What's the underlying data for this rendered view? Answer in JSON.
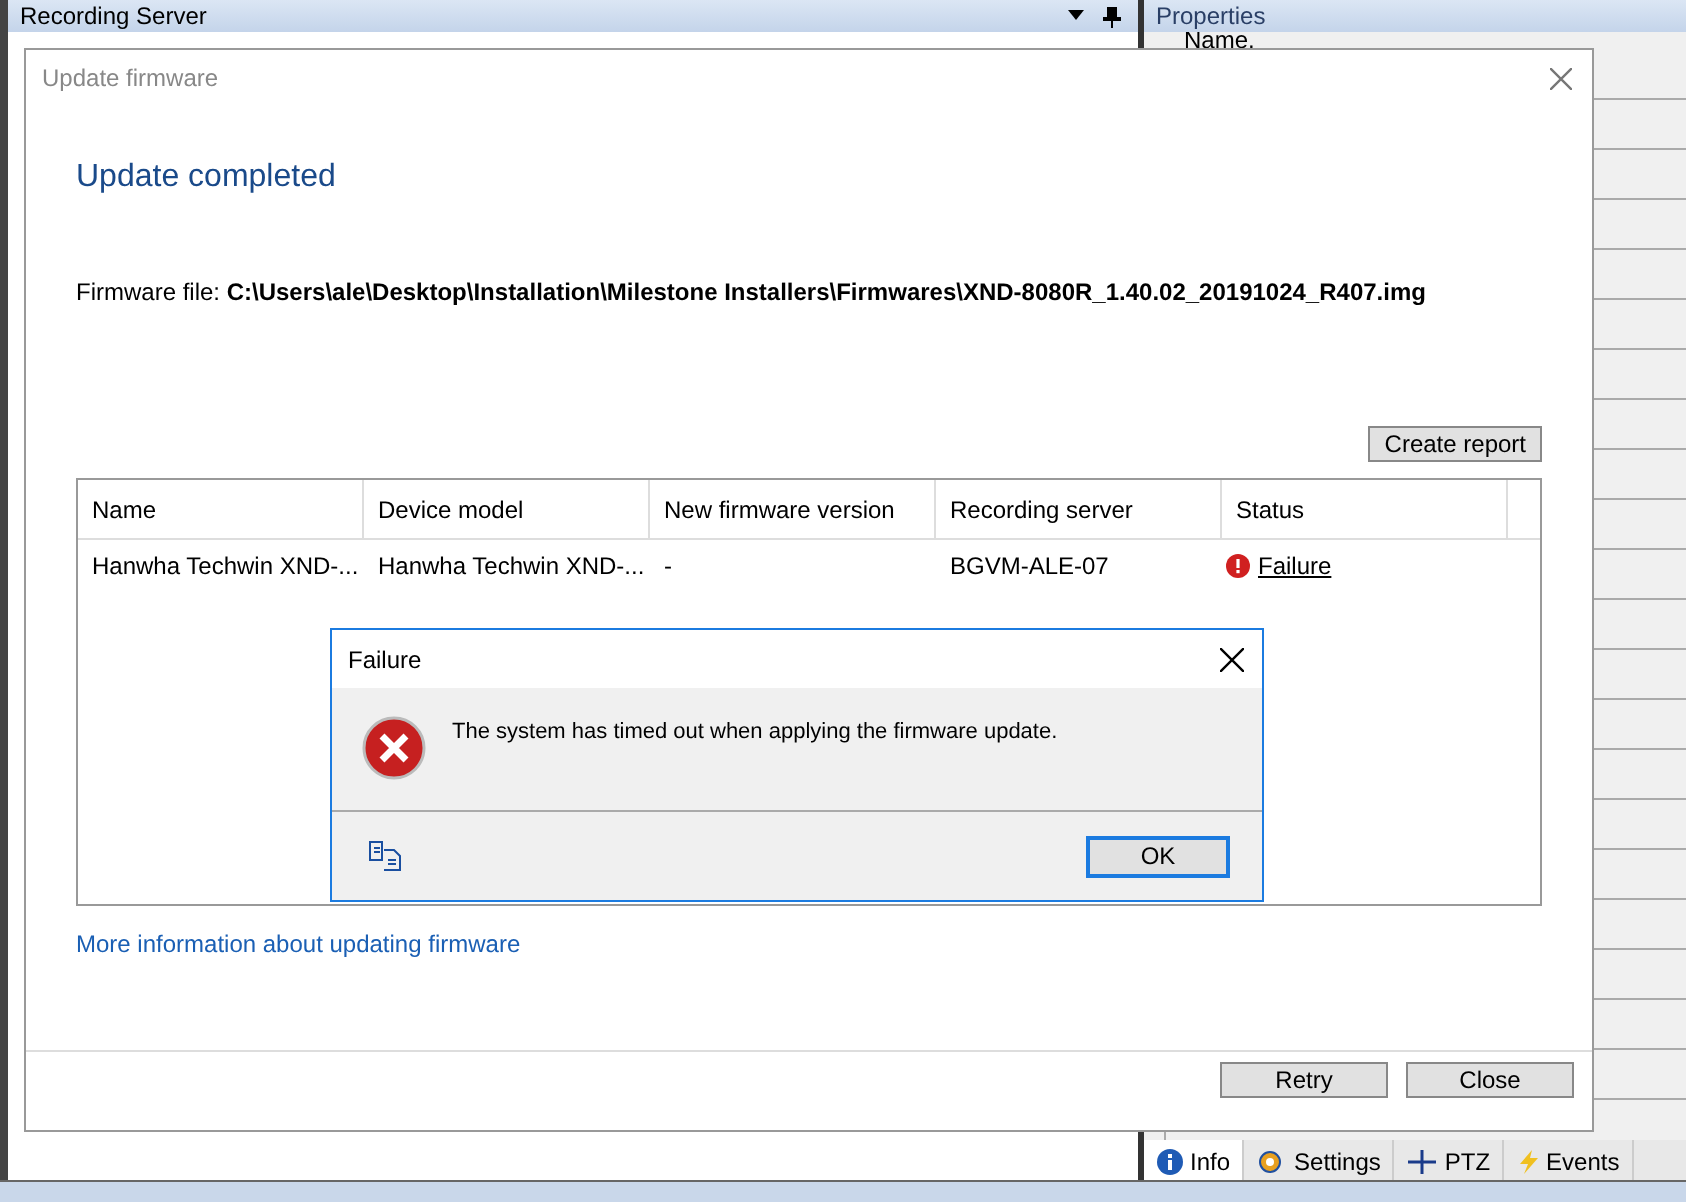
{
  "left_panel": {
    "title": "Recording Server"
  },
  "right_panel": {
    "title": "Properties",
    "field_label": "Name."
  },
  "bottom_tabs": [
    {
      "label": "Info",
      "selected": true,
      "kind": "info"
    },
    {
      "label": "Settings",
      "selected": false,
      "kind": "settings"
    },
    {
      "label": "PTZ",
      "selected": false,
      "kind": "ptz"
    },
    {
      "label": "Events",
      "selected": false,
      "kind": "events"
    }
  ],
  "update_dialog": {
    "title": "Update firmware",
    "heading": "Update completed",
    "file_label": "Firmware file:",
    "file_path": "C:\\Users\\ale\\Desktop\\Installation\\Milestone Installers\\Firmwares\\XND-8080R_1.40.02_20191024_R407.img",
    "report_button": "Create report",
    "table": {
      "columns": [
        "Name",
        "Device model",
        "New firmware version",
        "Recording server",
        "Status"
      ],
      "rows": [
        {
          "name": "Hanwha Techwin XND-...",
          "device_model": "Hanwha Techwin XND-...",
          "new_firmware_version": "-",
          "recording_server": "BGVM-ALE-07",
          "status": "Failure",
          "kind": "error"
        }
      ]
    },
    "link": "More information about updating firmware",
    "buttons": [
      "Retry",
      "Close"
    ]
  },
  "failure_dialog": {
    "title": "Failure",
    "message": "The system has timed out when applying the firmware update.",
    "button": "OK"
  }
}
